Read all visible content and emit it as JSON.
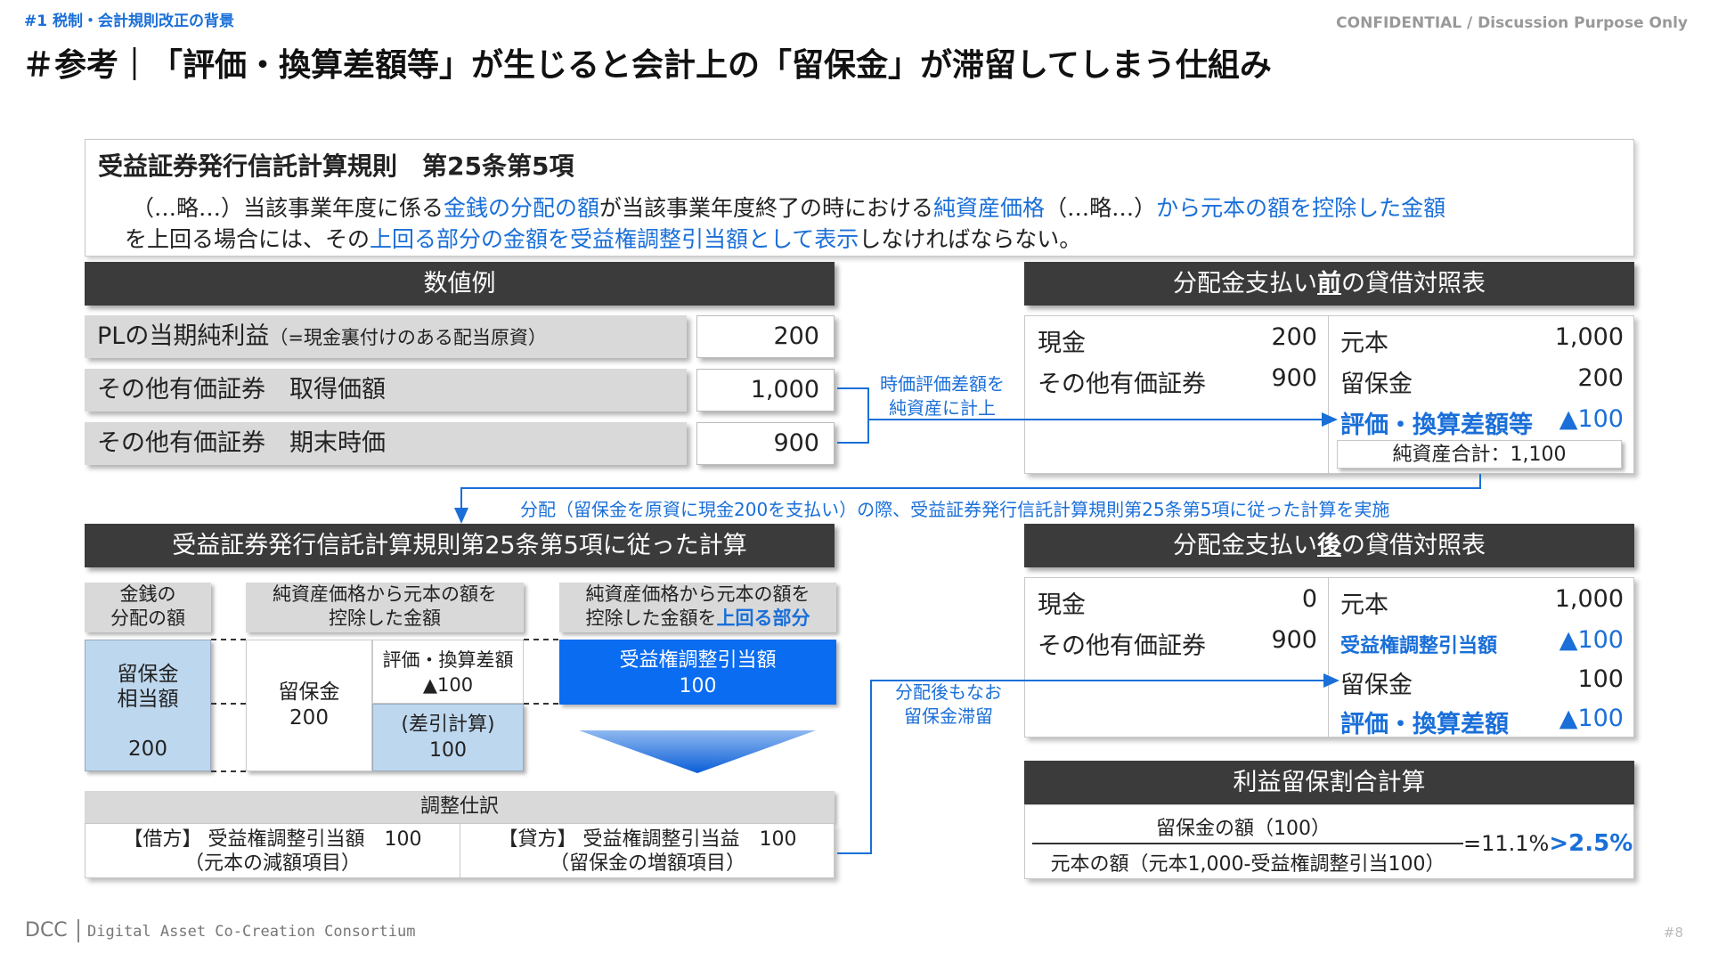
{
  "header": {
    "section": "#1 税制・会計規則改正の背景",
    "confidential": "CONFIDENTIAL / Discussion Purpose Only",
    "title": "＃参考｜「評価・換算差額等」が生じると会計上の「留保金」が滞留してしまう仕組み"
  },
  "rule": {
    "heading": "受益証券発行信託計算規則　第25条第5項",
    "line1_a": "（…略…）当該事業年度に係る",
    "line1_b": "金銭の分配の額",
    "line1_c": "が当該事業年度終了の時における",
    "line1_d": "純資産価格",
    "line1_e": "（…略…）",
    "line1_f": "から元本の額を控除した金額",
    "line2_a": "を上回る場合には、その",
    "line2_b": "上回る部分の金額を受益権調整引当額として表示",
    "line2_c": "しなければならない。"
  },
  "numeric": {
    "header": "数値例",
    "rows": [
      {
        "label": "PLの当期純利益",
        "sub": "（=現金裏付けのある配当原資）",
        "value": "200"
      },
      {
        "label": "その他有価証券　取得価額",
        "sub": "",
        "value": "1,000"
      },
      {
        "label": "その他有価証券　期末時価",
        "sub": "",
        "value": "900"
      }
    ],
    "note": "時価評価差額を\n純資産に計上"
  },
  "bs_before": {
    "header_a": "分配金支払い",
    "header_b": "前",
    "header_c": "の貸借対照表",
    "assets": [
      {
        "label": "現金",
        "value": "200"
      },
      {
        "label": "その他有価証券",
        "value": "900"
      }
    ],
    "liabilities": [
      {
        "label": "元本",
        "value": "1,000"
      },
      {
        "label": "留保金",
        "value": "200"
      },
      {
        "label": "評価・換算差額等",
        "value": "▲100"
      }
    ],
    "total": "純資産合計：1,100"
  },
  "flow_note": "分配（留保金を原資に現金200を支払い）の際、受益証券発行信託計算規則第25条第5項に従った計算を実施",
  "calc": {
    "header": "受益証券発行信託計算規則第25条第5項に従った計算",
    "cap1": "金銭の\n分配の額",
    "cap2": "純資産価格から元本の額を\n控除した金額",
    "cap3_a": "純資産価格から元本の額を\n控除した金額を",
    "cap3_b": "上回る部分",
    "box1": "留保金\n相当額\n\n200",
    "box2": "留保金\n200",
    "box3": "評価・換算差額\n▲100",
    "box4": "(差引計算)\n100",
    "box5": "受益権調整引当額\n100"
  },
  "journal": {
    "header": "調整仕訳",
    "debit": "【借方】 受益権調整引当額　100\n（元本の減額項目）",
    "credit": "【貸方】 受益権調整引当益　100\n（留保金の増額項目）"
  },
  "retained_note": "分配後もなお\n留保金滞留",
  "bs_after": {
    "header_a": "分配金支払い",
    "header_b": "後",
    "header_c": "の貸借対照表",
    "assets": [
      {
        "label": "現金",
        "value": "0"
      },
      {
        "label": "その他有価証券",
        "value": "900"
      }
    ],
    "liabilities": [
      {
        "label": "元本",
        "value": "1,000"
      },
      {
        "label": "受益権調整引当額",
        "value": "▲100"
      },
      {
        "label": "留保金",
        "value": "100"
      },
      {
        "label": "評価・換算差額",
        "value": "▲100"
      }
    ]
  },
  "ratio": {
    "header": "利益留保割合計算",
    "numerator": "留保金の額（100）",
    "denominator": "元本の額（元本1,000-受益権調整引当100）",
    "result_a": "=11.1%",
    "result_b": ">2.5%"
  },
  "footer": {
    "logo": "DCC",
    "org": "Digital Asset Co-Creation Consortium",
    "page": "#8"
  },
  "colors": {
    "accent": "#1a6fd8",
    "dark": "#3b3b3b",
    "light_blue": "#bdd7ee",
    "bright_blue": "#0a6cf0"
  }
}
